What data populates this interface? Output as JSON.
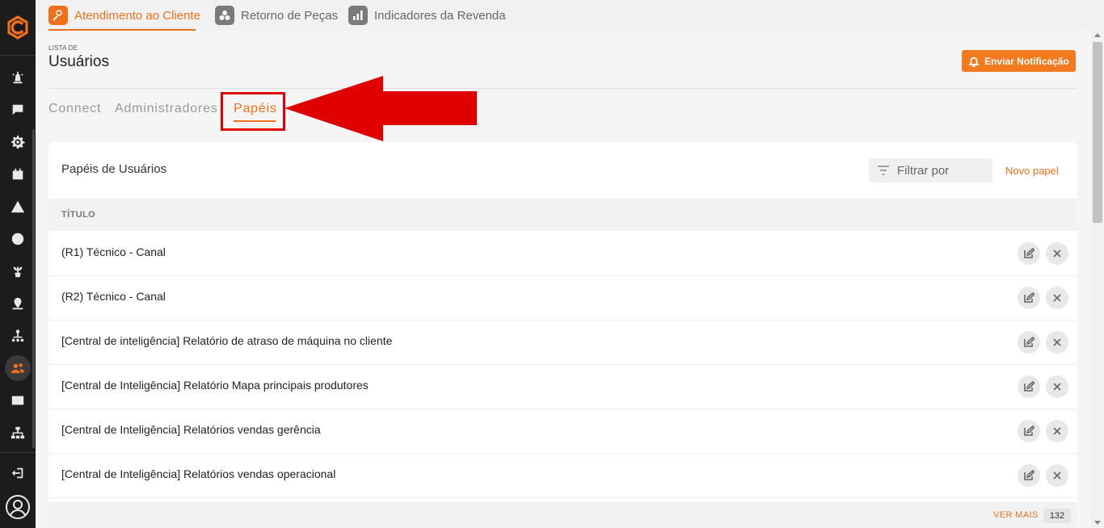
{
  "top_tabs": [
    {
      "label": "Atendimento ao Cliente",
      "active": true
    },
    {
      "label": "Retorno de Peças",
      "active": false
    },
    {
      "label": "Indicadores da Revenda",
      "active": false
    }
  ],
  "page": {
    "kicker": "LISTA DE",
    "title": "Usuários",
    "notify_label": "Enviar Notificação"
  },
  "sub_tabs": [
    {
      "label": "Connect",
      "active": false
    },
    {
      "label": "Administradores",
      "active": false
    },
    {
      "label": "Papéis",
      "active": true
    }
  ],
  "card": {
    "title": "Papéis de Usuários",
    "filter_placeholder": "Filtrar por",
    "new_label": "Novo papel",
    "column_header": "TÍTULO",
    "rows": [
      "(R1) Técnico - Canal",
      "(R2) Técnico - Canal",
      "[Central de inteligência] Relatório de atraso de máquina no cliente",
      "[Central de Inteligência] Relatório Mapa principais produtores",
      "[Central de Inteligência] Relatórios vendas gerência",
      "[Central de Inteligência] Relatórios vendas operacional"
    ],
    "see_more": "VER MAIS",
    "total_count": "132"
  },
  "colors": {
    "accent": "#f0701a",
    "sidebar": "#1c1c1c",
    "annotation": "#e00000"
  }
}
